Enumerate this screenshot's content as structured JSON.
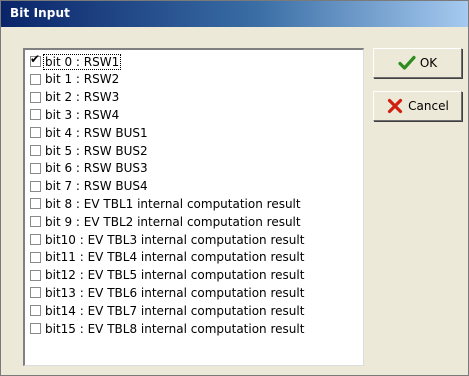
{
  "window": {
    "title": "Bit Input"
  },
  "items": [
    {
      "label": "bit 0 : RSW1",
      "checked": true
    },
    {
      "label": "bit 1 : RSW2",
      "checked": false
    },
    {
      "label": "bit 2 : RSW3",
      "checked": false
    },
    {
      "label": "bit 3 : RSW4",
      "checked": false
    },
    {
      "label": "bit 4 : RSW BUS1",
      "checked": false
    },
    {
      "label": "bit 5 : RSW BUS2",
      "checked": false
    },
    {
      "label": "bit 6 : RSW BUS3",
      "checked": false
    },
    {
      "label": "bit 7 : RSW BUS4",
      "checked": false
    },
    {
      "label": "bit 8 : EV TBL1 internal computation result",
      "checked": false
    },
    {
      "label": "bit 9 : EV TBL2 internal computation result",
      "checked": false
    },
    {
      "label": "bit10 : EV TBL3 internal computation result",
      "checked": false
    },
    {
      "label": "bit11 : EV TBL4 internal computation result",
      "checked": false
    },
    {
      "label": "bit12 : EV TBL5 internal computation result",
      "checked": false
    },
    {
      "label": "bit13 : EV TBL6 internal computation result",
      "checked": false
    },
    {
      "label": "bit14 : EV TBL7 internal computation result",
      "checked": false
    },
    {
      "label": "bit15 : EV TBL8 internal computation result",
      "checked": false
    }
  ],
  "buttons": {
    "ok_label": "OK",
    "ok_icon": "checkmark-icon",
    "cancel_label": "Cancel",
    "cancel_icon": "red-x-icon"
  },
  "colors": {
    "title_gradient_start": "#0a246a",
    "title_gradient_end": "#a6caf0",
    "dialog_background": "#ece9d8",
    "ok_icon_color": "#2e8b1e",
    "cancel_icon_color": "#d02010"
  }
}
